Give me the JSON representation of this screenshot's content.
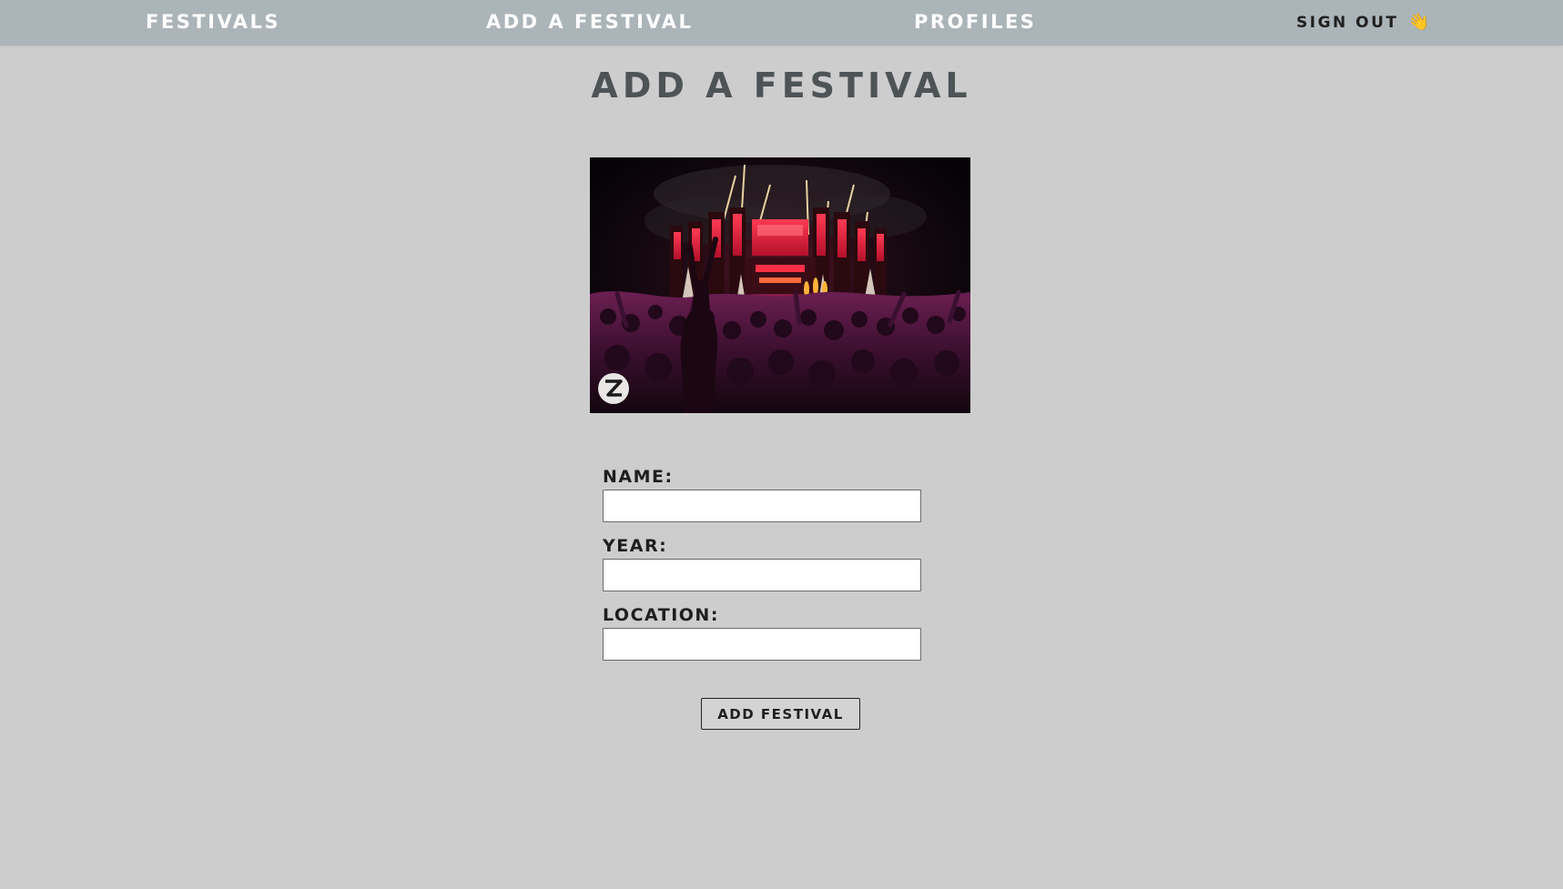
{
  "nav": {
    "festivals": "Festivals",
    "add_festival": "Add a Festival",
    "profiles": "Profiles",
    "sign_out": "Sign Out",
    "sign_out_icon": "waving-hand-icon"
  },
  "page": {
    "title": "Add a Festival"
  },
  "hero": {
    "image": "festival-stage-crowd-fireworks",
    "badge_icon": "z-logo-icon"
  },
  "form": {
    "name_label": "Name:",
    "name_value": "",
    "year_label": "Year:",
    "year_value": "",
    "location_label": "Location:",
    "location_value": "",
    "submit_label": "Add Festival"
  },
  "colors": {
    "background": "#cdcdcd",
    "navbar": "#abb4b8",
    "title": "#4e5356",
    "stage_red": "#e0203c"
  }
}
